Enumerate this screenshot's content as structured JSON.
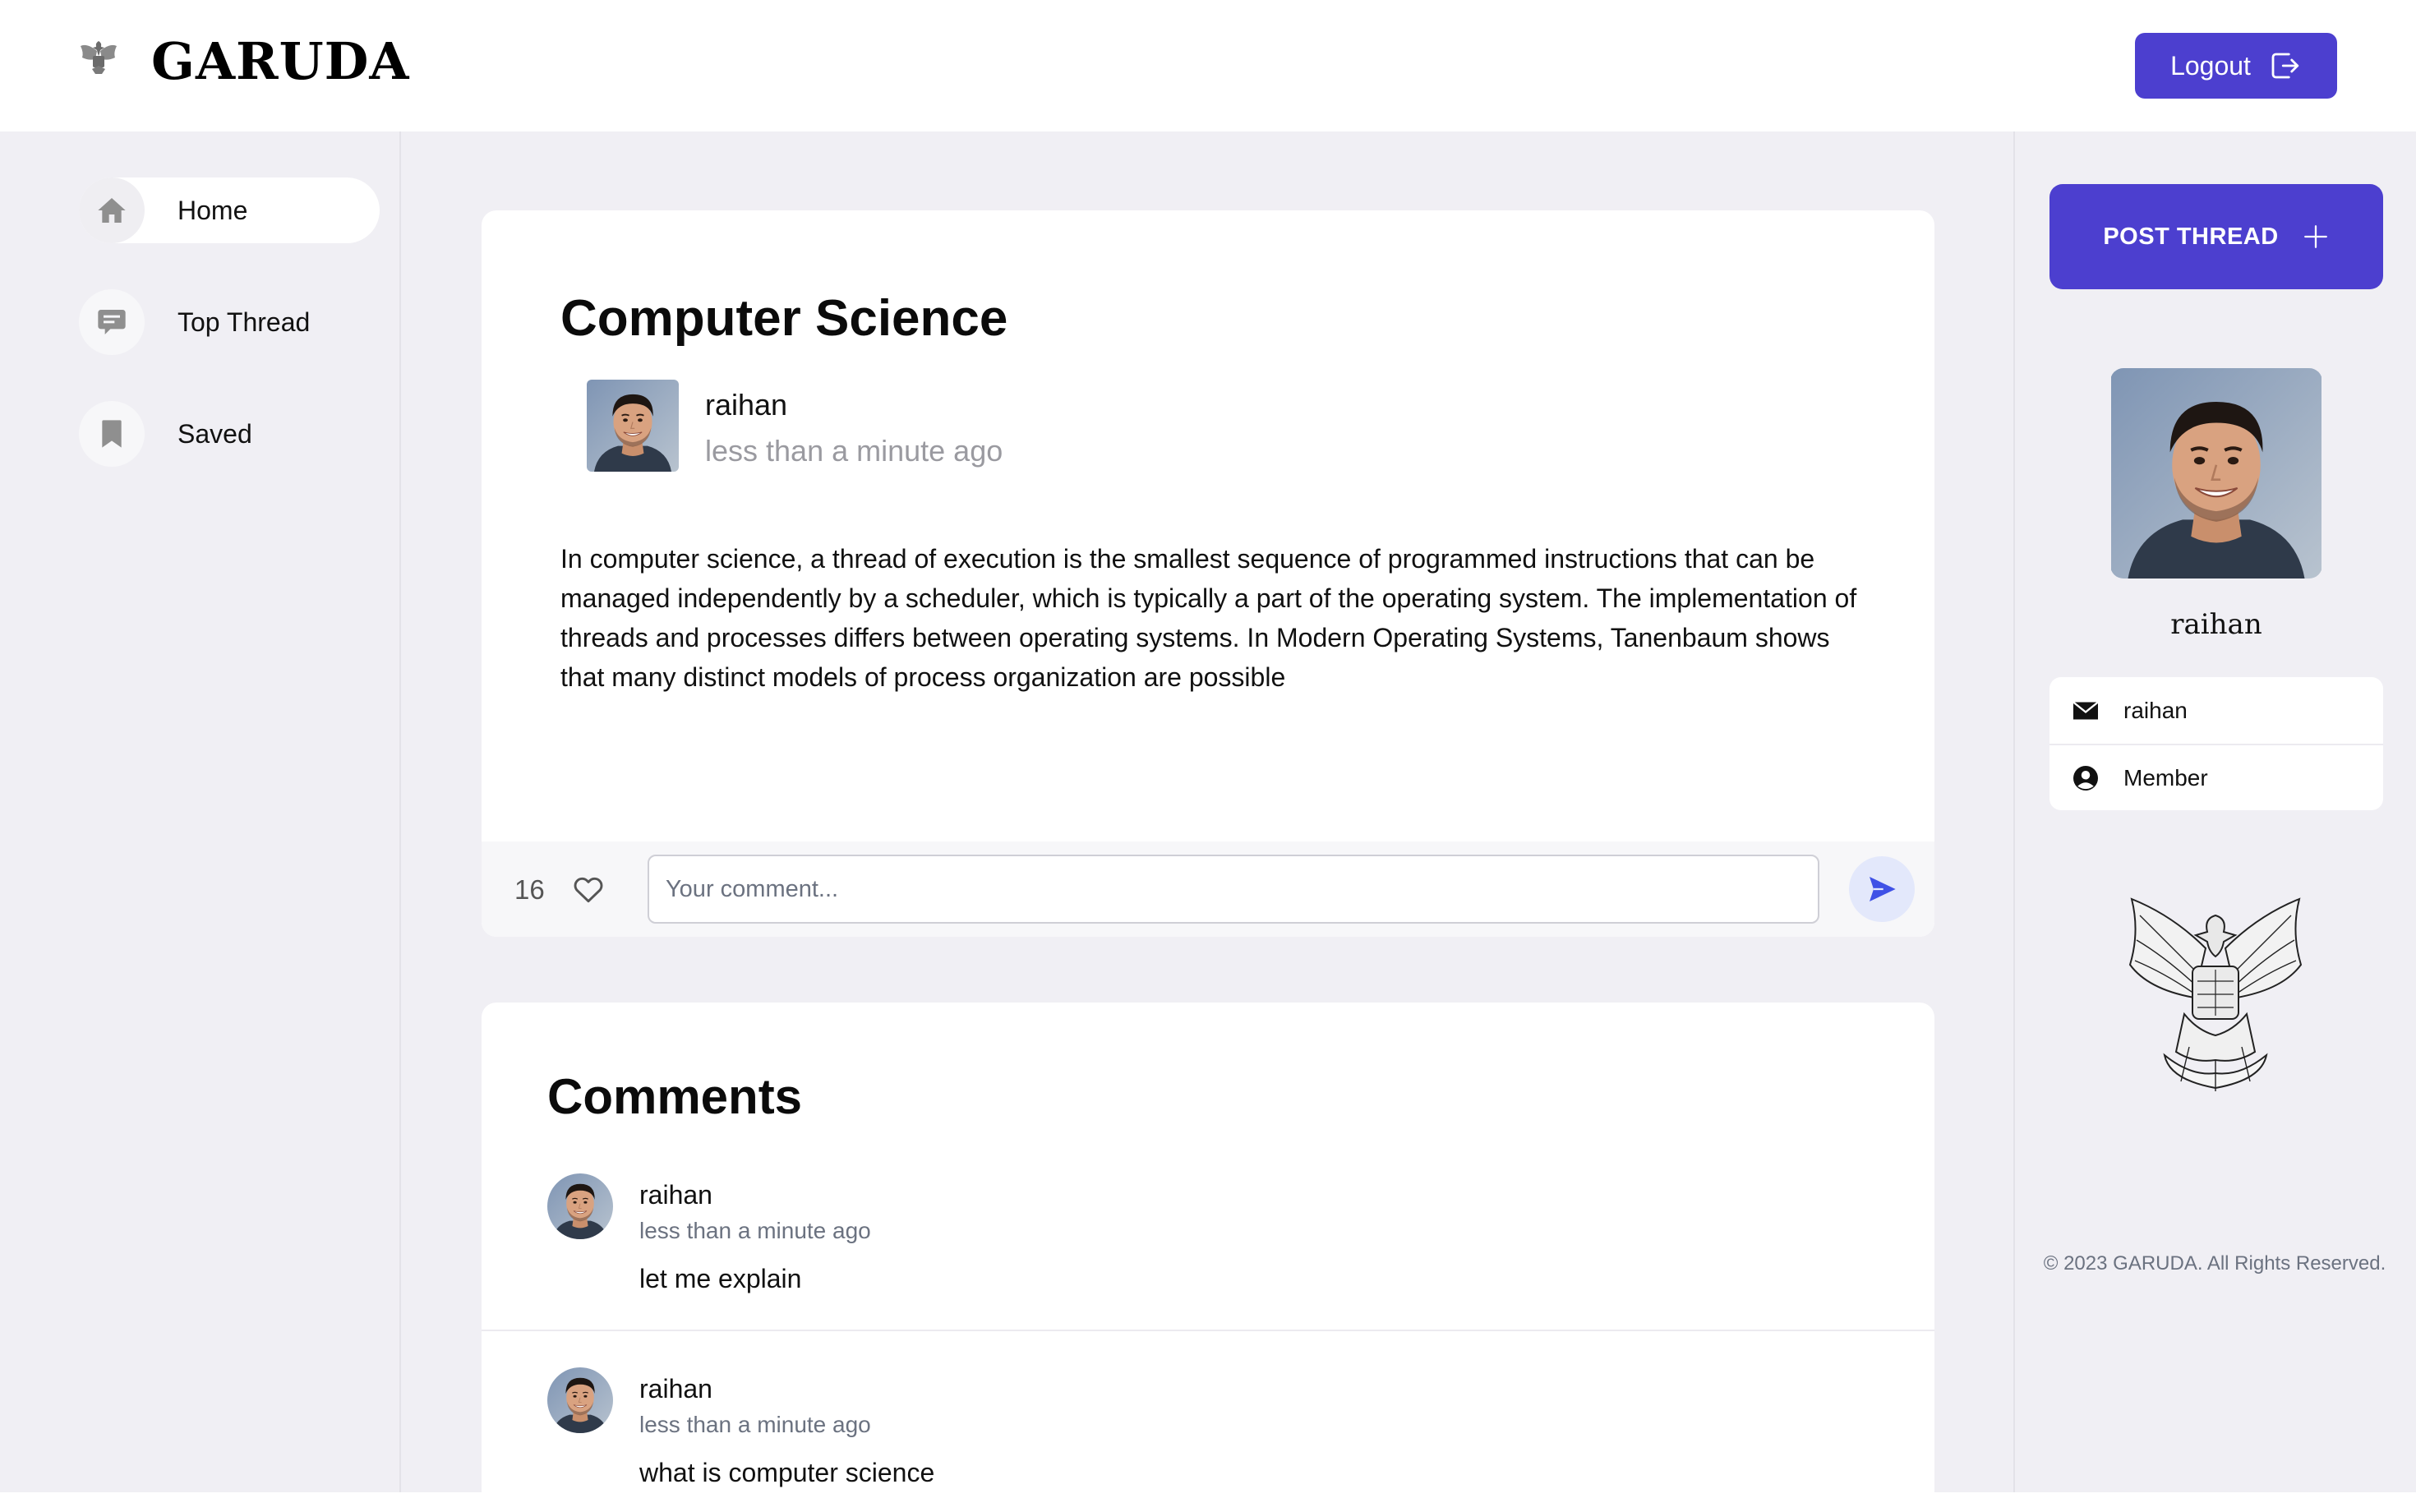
{
  "header": {
    "brand": "GARUDA",
    "logout_label": "Logout"
  },
  "sidebar": {
    "items": [
      {
        "label": "Home",
        "icon": "home-icon",
        "active": true
      },
      {
        "label": "Top Thread",
        "icon": "chat-icon",
        "active": false
      },
      {
        "label": "Saved",
        "icon": "bookmark-icon",
        "active": false
      }
    ]
  },
  "thread": {
    "title": "Computer Science",
    "author": "raihan",
    "time": "less than a minute ago",
    "body": "In computer science, a thread of execution is the smallest sequence of programmed instructions that can be managed independently by a scheduler, which is typically a part of the operating system. The implementation of threads and processes differs between operating systems. In Modern Operating Systems, Tanenbaum shows that many distinct models of process organization are possible",
    "likes": "16",
    "comment_placeholder": "Your comment..."
  },
  "comments": {
    "title": "Comments",
    "items": [
      {
        "author": "raihan",
        "time": "less than a minute ago",
        "text": "let me explain"
      },
      {
        "author": "raihan",
        "time": "less than a minute ago",
        "text": "what is computer science"
      }
    ]
  },
  "profile": {
    "post_button_label": "POST THREAD",
    "name": "raihan",
    "email": "raihan",
    "role": "Member"
  },
  "footer": {
    "copyright": "© 2023 GARUDA. All Rights Reserved."
  },
  "colors": {
    "accent": "#4c3fcf",
    "background": "#f0eff4",
    "send_icon": "#3f51e6"
  }
}
